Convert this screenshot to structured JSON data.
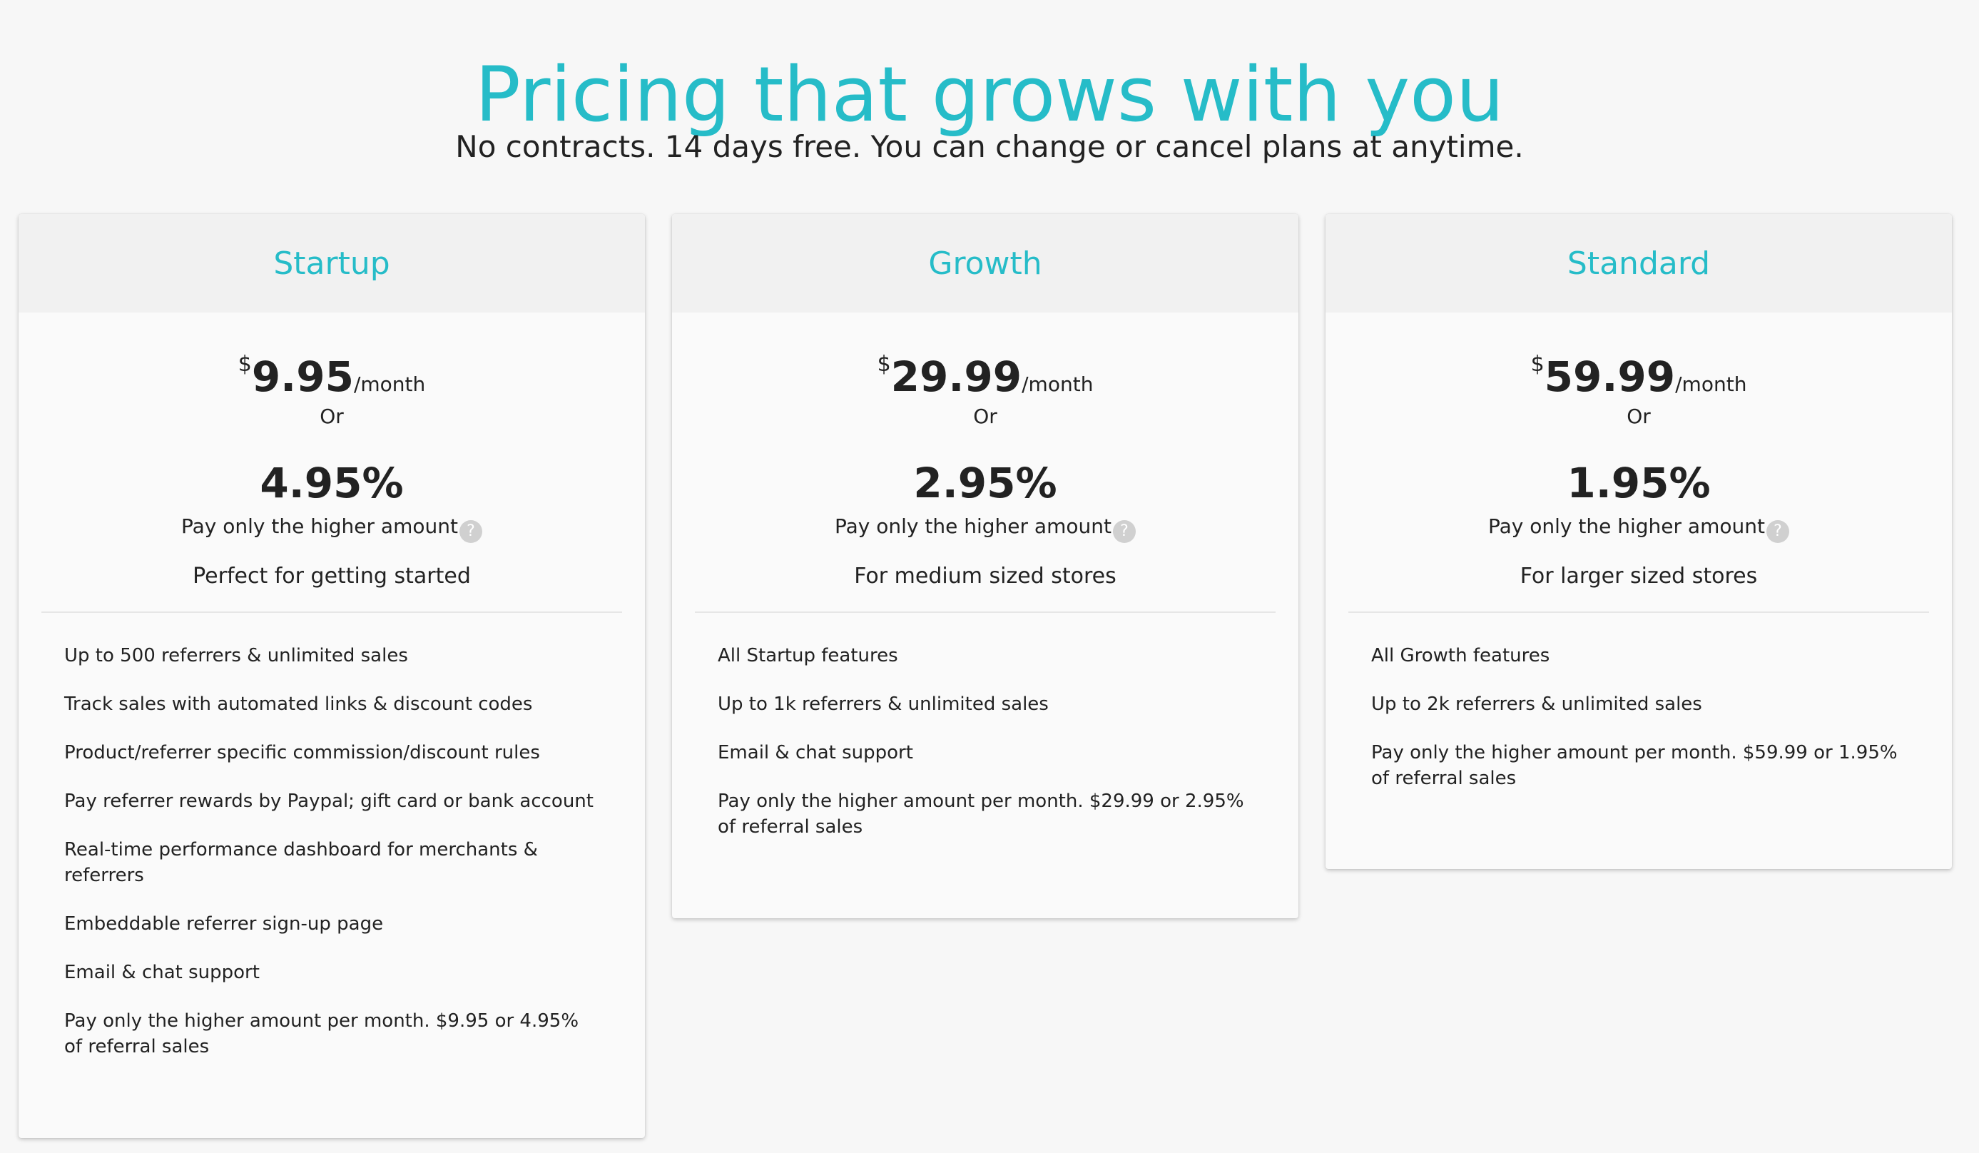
{
  "hero": {
    "title": "Pricing that grows with you",
    "subtitle": "No contracts. 14 days free. You can change or cancel plans at anytime."
  },
  "colors": {
    "accent": "#26bcc8",
    "text": "#222222",
    "card_header_bg": "#f1f1f1",
    "page_bg": "#f7f7f7",
    "help_icon_bg": "#d0d0d0"
  },
  "plans": [
    {
      "name": "Startup",
      "currency": "$",
      "price": "9.95",
      "period": "/month",
      "or": "Or",
      "percent": "4.95%",
      "higher_amount": "Pay only the higher amount",
      "help_icon": "?",
      "tagline": "Perfect for getting started",
      "features": [
        "Up to 500 referrers & unlimited sales",
        "Track sales with automated links & discount codes",
        "Product/referrer specific commission/discount rules",
        "Pay referrer rewards by Paypal; gift card or bank account",
        "Real-time performance dashboard for merchants & referrers",
        "Embeddable referrer sign-up page",
        "Email & chat support",
        "Pay only the higher amount per month. $9.95 or 4.95% of referral sales"
      ]
    },
    {
      "name": "Growth",
      "currency": "$",
      "price": "29.99",
      "period": "/month",
      "or": "Or",
      "percent": "2.95%",
      "higher_amount": "Pay only the higher amount",
      "help_icon": "?",
      "tagline": "For medium sized stores",
      "features": [
        "All Startup features",
        "Up to 1k referrers & unlimited sales",
        "Email & chat support",
        "Pay only the higher amount per month. $29.99 or 2.95% of referral sales"
      ]
    },
    {
      "name": "Standard",
      "currency": "$",
      "price": "59.99",
      "period": "/month",
      "or": "Or",
      "percent": "1.95%",
      "higher_amount": "Pay only the higher amount",
      "help_icon": "?",
      "tagline": "For larger sized stores",
      "features": [
        "All Growth features",
        "Up to 2k referrers & unlimited sales",
        "Pay only the higher amount per month. $59.99 or 1.95% of referral sales"
      ]
    }
  ]
}
